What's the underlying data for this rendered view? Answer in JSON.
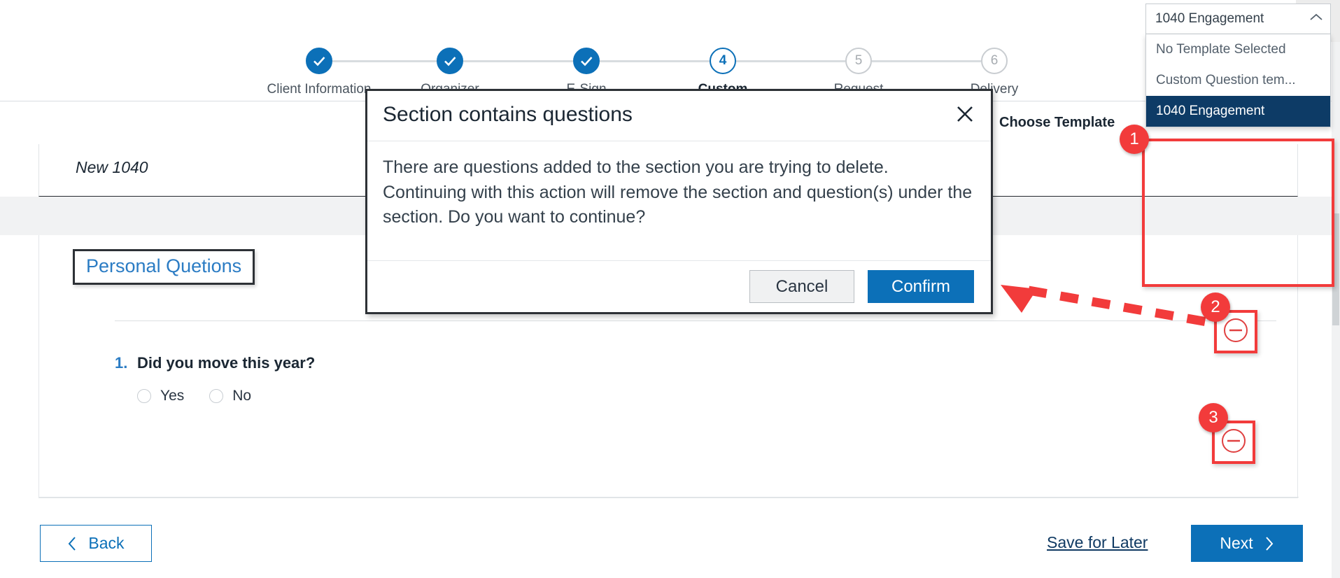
{
  "window": {
    "close_icon": "close-icon"
  },
  "stepper": {
    "steps": [
      {
        "number": "1",
        "label": "Client Information",
        "state": "done",
        "check_icon": "check-icon"
      },
      {
        "number": "2",
        "label": "Organizer",
        "state": "done",
        "check_icon": "check-icon"
      },
      {
        "number": "3",
        "label": "E-Sign",
        "state": "done",
        "check_icon": "check-icon"
      },
      {
        "number": "4",
        "label": "Custom",
        "state": "current"
      },
      {
        "number": "5",
        "label": "Request",
        "state": "todo"
      },
      {
        "number": "6",
        "label": "Delivery",
        "state": "todo"
      }
    ]
  },
  "template": {
    "label": "Choose Template",
    "selected_value": "1040 Engagement",
    "chevron_icon": "chevron-up-icon",
    "options": [
      "No Template Selected",
      "Custom Question tem...",
      "1040 Engagement"
    ],
    "selected_index": 2
  },
  "document": {
    "name": "New 1040"
  },
  "section": {
    "title": "Personal Quetions",
    "questions": [
      {
        "number": "1.",
        "text": "Did you move this year?",
        "options": [
          "Yes",
          "No"
        ]
      }
    ]
  },
  "modal": {
    "title": "Section contains questions",
    "close_icon": "close-icon",
    "body": "There are questions added to the section you are trying to delete. Continuing with this action will remove the section and question(s) under the section. Do you want to continue?",
    "cancel_label": "Cancel",
    "confirm_label": "Confirm"
  },
  "footer": {
    "back_label": "Back",
    "back_icon": "chevron-left-icon",
    "save_label": "Save for Later",
    "next_label": "Next",
    "next_icon": "chevron-right-icon"
  },
  "annotations": {
    "markers": [
      {
        "id": "1",
        "target": "template-dropdown"
      },
      {
        "id": "2",
        "target": "remove-section-button"
      },
      {
        "id": "3",
        "target": "remove-question-button"
      }
    ],
    "arrow_icon": "dashed-arrow-left-icon",
    "minus_icon": "minus-circle-icon",
    "accent_color": "#f23b3b"
  },
  "colors": {
    "primary_blue": "#0c70b8",
    "dark_navy": "#0d3b66",
    "annotation_red": "#f23b3b",
    "link_blue": "#2b7cc4"
  }
}
